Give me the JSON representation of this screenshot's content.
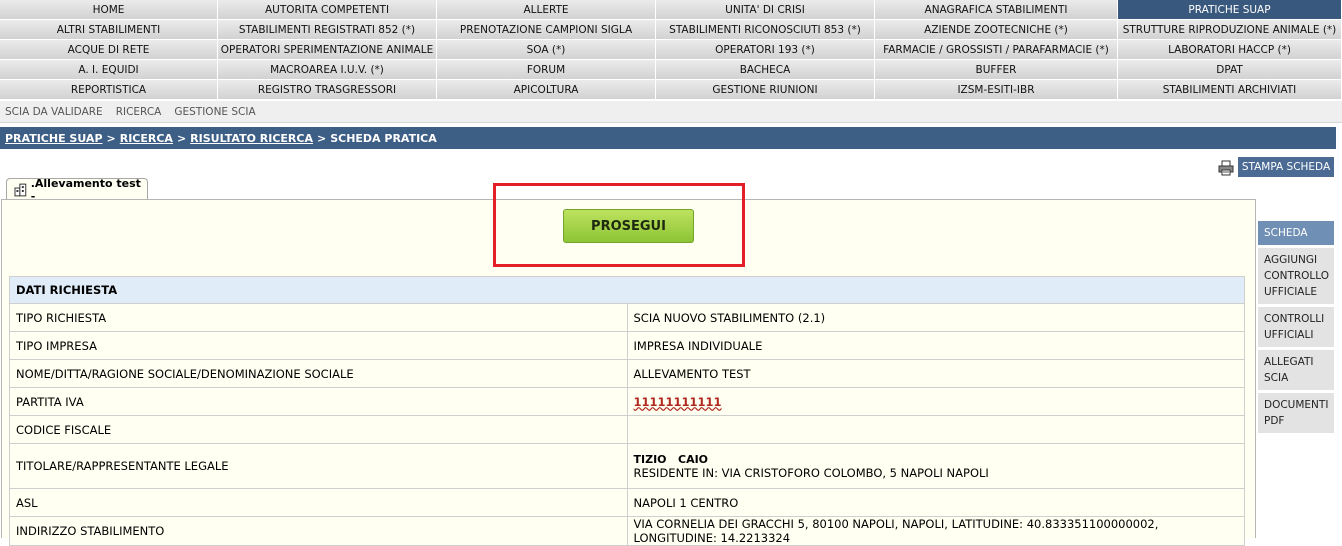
{
  "menu": [
    [
      {
        "label": "HOME"
      },
      {
        "label": "AUTORITA COMPETENTI"
      },
      {
        "label": "ALLERTE"
      },
      {
        "label": "UNITA' DI CRISI"
      },
      {
        "label": "ANAGRAFICA STABILIMENTI"
      },
      {
        "label": "PRATICHE SUAP",
        "active": true
      }
    ],
    [
      {
        "label": "ALTRI STABILIMENTI"
      },
      {
        "label": "STABILIMENTI REGISTRATI 852 (*)"
      },
      {
        "label": "PRENOTAZIONE CAMPIONI SIGLA"
      },
      {
        "label": "STABILIMENTI RICONOSCIUTI 853 (*)"
      },
      {
        "label": "AZIENDE ZOOTECNICHE (*)"
      },
      {
        "label": "STRUTTURE RIPRODUZIONE ANIMALE (*)"
      }
    ],
    [
      {
        "label": "ACQUE DI RETE"
      },
      {
        "label": "OPERATORI SPERIMENTAZIONE ANIMALE"
      },
      {
        "label": "SOA (*)"
      },
      {
        "label": "OPERATORI 193 (*)"
      },
      {
        "label": "FARMACIE / GROSSISTI / PARAFARMACIE (*)"
      },
      {
        "label": "LABORATORI HACCP (*)"
      }
    ],
    [
      {
        "label": "A. I. EQUIDI"
      },
      {
        "label": "MACROAREA I.U.V. (*)"
      },
      {
        "label": "FORUM"
      },
      {
        "label": "BACHECA"
      },
      {
        "label": "BUFFER"
      },
      {
        "label": "DPAT"
      }
    ],
    [
      {
        "label": "REPORTISTICA"
      },
      {
        "label": "REGISTRO TRASGRESSORI"
      },
      {
        "label": "APICOLTURA"
      },
      {
        "label": "GESTIONE RIUNIONI"
      },
      {
        "label": "IZSM-ESITI-IBR"
      },
      {
        "label": "STABILIMENTI ARCHIVIATI"
      }
    ]
  ],
  "submenu": [
    "SCIA DA VALIDARE",
    "RICERCA",
    "GESTIONE SCIA"
  ],
  "breadcrumb": {
    "links": [
      "PRATICHE SUAP",
      "RICERCA",
      "RISULTATO RICERCA"
    ],
    "sep": ">",
    "current": "SCHEDA PRATICA"
  },
  "print": {
    "label": "STAMPA SCHEDA",
    "icon": "printer-icon"
  },
  "tab": {
    "label": ".Allevamento test -",
    "icon": "building-icon"
  },
  "prosegui_label": "PROSEGUI",
  "details": {
    "header": "DATI RICHIESTA",
    "rows": [
      {
        "label": "TIPO RICHIESTA",
        "value": "SCIA NUOVO STABILIMENTO (2.1)"
      },
      {
        "label": "TIPO IMPRESA",
        "value": "IMPRESA INDIVIDUALE"
      },
      {
        "label": "NOME/DITTA/RAGIONE SOCIALE/DENOMINAZIONE SOCIALE",
        "value": "ALLEVAMENTO TEST"
      },
      {
        "label": "PARTITA IVA",
        "value": "11111111111"
      },
      {
        "label": "CODICE FISCALE",
        "value": ""
      },
      {
        "label": "TITOLARE/RAPPRESENTANTE LEGALE",
        "value_name": "TIZIO   CAIO",
        "value_address": "RESIDENTE IN: VIA CRISTOFORO COLOMBO, 5 NAPOLI NAPOLI"
      },
      {
        "label": "ASL",
        "value": "NAPOLI 1 CENTRO"
      },
      {
        "label": "INDIRIZZO STABILIMENTO",
        "value": "VIA CORNELIA DEI GRACCHI 5, 80100 NAPOLI, NAPOLI, LATITUDINE: 40.833351100000002, LONGITUDINE: 14.2213324"
      }
    ]
  },
  "sidenav": [
    {
      "label": "SCHEDA",
      "active": true
    },
    {
      "label": "AGGIUNGI CONTROLLO UFFICIALE"
    },
    {
      "label": "CONTROLLI UFFICIALI"
    },
    {
      "label": "ALLEGATI SCIA"
    },
    {
      "label": "DOCUMENTI PDF"
    }
  ],
  "colors": {
    "active_menu": "#39587d",
    "breadcrumb": "#3d5e85",
    "highlight": "#e3202a",
    "prosegui": "#8dc435"
  }
}
